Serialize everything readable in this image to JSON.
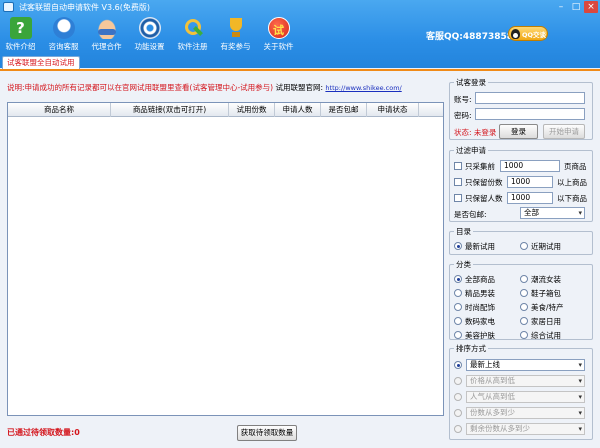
{
  "window": {
    "title": "试客联盟自动申请软件 V3.6(免费版)",
    "controls": [
      "–",
      "□",
      "×"
    ]
  },
  "toolbar": {
    "items": [
      {
        "label": "软件介绍",
        "icon": "help-icon"
      },
      {
        "label": "咨询客服",
        "icon": "chat-icon"
      },
      {
        "label": "代理合作",
        "icon": "handshake-icon"
      },
      {
        "label": "功能设置",
        "icon": "gear-icon"
      },
      {
        "label": "软件注册",
        "icon": "key-icon"
      },
      {
        "label": "有奖参与",
        "icon": "trophy-icon"
      },
      {
        "label": "关于软件",
        "icon": "try-badge-icon"
      }
    ],
    "service_qq": "客服QQ:488738580",
    "qq_button": "QQ交谈"
  },
  "tabs": {
    "active": "试客联盟全自动试用"
  },
  "notice": {
    "text": "说明:申请成功的所有记录都可以在官网试用联盟里查看(试客管理中心-试用参与)",
    "site_label": "试用联盟官网:",
    "site_url": "http://www.shikee.com/"
  },
  "table": {
    "columns": [
      "商品名称",
      "商品链接(双击可打开)",
      "试用份数",
      "申请人数",
      "是否包邮",
      "申请状态"
    ],
    "rows": []
  },
  "footer": {
    "count_label": "已通过待领取数量:0",
    "fetch_button": "获取待领取数量"
  },
  "login": {
    "title": "试客登录",
    "account_label": "账号:",
    "password_label": "密码:",
    "status": "状态: 未登录",
    "login_button": "登录",
    "start_button": "开始申请"
  },
  "filter": {
    "title": "过滤申请",
    "only_collect": {
      "label": "只采集前",
      "value": "1000",
      "unit": "页商品"
    },
    "only_keep_count": {
      "label": "只保留份数",
      "value": "1000",
      "unit": "以上商品"
    },
    "only_keep_people": {
      "label": "只保留人数",
      "value": "1000",
      "unit": "以下商品"
    },
    "free_shipping_label": "是否包邮:",
    "free_shipping_value": "全部"
  },
  "catalog": {
    "title": "目录",
    "options": [
      "最新试用",
      "近期试用"
    ],
    "selected": "最新试用"
  },
  "category": {
    "title": "分类",
    "options": [
      "全部商品",
      "潮流女装",
      "精品男装",
      "鞋子箱包",
      "时尚配饰",
      "美食/特产",
      "数码家电",
      "家居日用",
      "美容护肤",
      "综合试用"
    ],
    "selected": "全部商品"
  },
  "sort": {
    "title": "排序方式",
    "options": [
      "最新上线",
      "价格从高到低",
      "人气从高到低",
      "份数从多到少",
      "剩余份数从多到少"
    ],
    "selected": "最新上线"
  }
}
